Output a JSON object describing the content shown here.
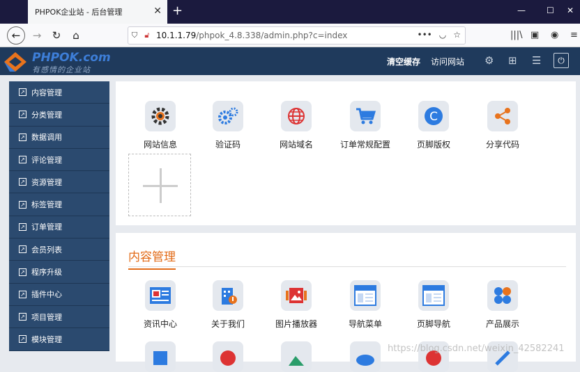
{
  "browser": {
    "tab_title": "PHPOK企业站 - 后台管理",
    "url_host": "10.1.1.79",
    "url_path": "/phpok_4.8.338/admin.php?c=index"
  },
  "header": {
    "logo_name": "PHPOK.com",
    "logo_tagline": "有感情的企业站",
    "clear_cache": "清空缓存",
    "visit_site": "访问网站"
  },
  "sidebar": {
    "items": [
      {
        "label": "内容管理"
      },
      {
        "label": "分类管理"
      },
      {
        "label": "数据调用"
      },
      {
        "label": "评论管理"
      },
      {
        "label": "资源管理"
      },
      {
        "label": "标签管理"
      },
      {
        "label": "订单管理"
      },
      {
        "label": "会员列表"
      },
      {
        "label": "程序升级"
      },
      {
        "label": "插件中心"
      },
      {
        "label": "项目管理"
      },
      {
        "label": "模块管理"
      }
    ]
  },
  "settings_tiles": [
    {
      "label": "网站信息",
      "icon": "gear-icon"
    },
    {
      "label": "验证码",
      "icon": "gears-icon"
    },
    {
      "label": "网站域名",
      "icon": "globe-icon"
    },
    {
      "label": "订单常规配置",
      "icon": "cart-icon"
    },
    {
      "label": "页脚版权",
      "icon": "copyright-icon"
    },
    {
      "label": "分享代码",
      "icon": "share-icon"
    }
  ],
  "content_section": {
    "title": "内容管理",
    "tiles": [
      {
        "label": "资讯中心",
        "icon": "news-icon"
      },
      {
        "label": "关于我们",
        "icon": "building-icon"
      },
      {
        "label": "图片播放器",
        "icon": "image-icon"
      },
      {
        "label": "导航菜单",
        "icon": "browser-icon"
      },
      {
        "label": "页脚导航",
        "icon": "browser-icon"
      },
      {
        "label": "产品展示",
        "icon": "grid-icon"
      }
    ]
  },
  "watermark": "https://blog.csdn.net/weixin_42582241"
}
